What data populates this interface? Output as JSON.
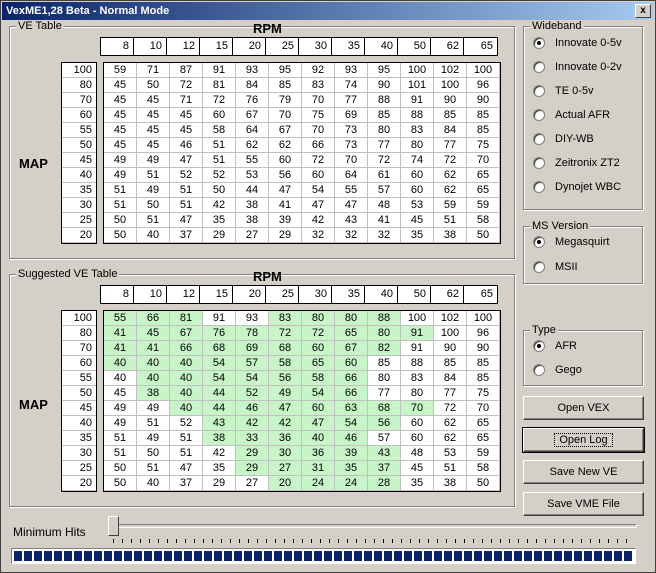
{
  "window": {
    "title": "VexME1,28 Beta - Normal Mode",
    "close_label": "x"
  },
  "ve_table": {
    "group_label": "VE Table",
    "rpm_label": "RPM",
    "map_label": "MAP",
    "rpm": [
      "8",
      "10",
      "12",
      "15",
      "20",
      "25",
      "30",
      "35",
      "40",
      "50",
      "62",
      "65"
    ],
    "map": [
      "100",
      "80",
      "70",
      "60",
      "55",
      "50",
      "45",
      "40",
      "35",
      "30",
      "25",
      "20"
    ],
    "rows": [
      [
        "59",
        "71",
        "87",
        "91",
        "93",
        "95",
        "92",
        "93",
        "95",
        "100",
        "102",
        "100"
      ],
      [
        "45",
        "50",
        "72",
        "81",
        "84",
        "85",
        "83",
        "74",
        "90",
        "101",
        "100",
        "96"
      ],
      [
        "45",
        "45",
        "71",
        "72",
        "76",
        "79",
        "70",
        "77",
        "88",
        "91",
        "90",
        "90"
      ],
      [
        "45",
        "45",
        "45",
        "60",
        "67",
        "70",
        "75",
        "69",
        "85",
        "88",
        "85",
        "85"
      ],
      [
        "45",
        "45",
        "45",
        "58",
        "64",
        "67",
        "70",
        "73",
        "80",
        "83",
        "84",
        "85"
      ],
      [
        "45",
        "45",
        "46",
        "51",
        "62",
        "62",
        "66",
        "73",
        "77",
        "80",
        "77",
        "75"
      ],
      [
        "49",
        "49",
        "47",
        "51",
        "55",
        "60",
        "72",
        "70",
        "72",
        "74",
        "72",
        "70"
      ],
      [
        "49",
        "51",
        "52",
        "52",
        "53",
        "56",
        "60",
        "64",
        "61",
        "60",
        "62",
        "65"
      ],
      [
        "51",
        "49",
        "51",
        "50",
        "44",
        "47",
        "54",
        "55",
        "57",
        "60",
        "62",
        "65"
      ],
      [
        "51",
        "50",
        "51",
        "42",
        "38",
        "41",
        "47",
        "47",
        "48",
        "53",
        "59",
        "59"
      ],
      [
        "50",
        "51",
        "47",
        "35",
        "38",
        "39",
        "42",
        "43",
        "41",
        "45",
        "51",
        "58"
      ],
      [
        "50",
        "40",
        "37",
        "29",
        "27",
        "29",
        "32",
        "32",
        "32",
        "35",
        "38",
        "50"
      ]
    ]
  },
  "suggested_table": {
    "group_label": "Suggested VE Table",
    "rpm_label": "RPM",
    "map_label": "MAP",
    "rpm": [
      "8",
      "10",
      "12",
      "15",
      "20",
      "25",
      "30",
      "35",
      "40",
      "50",
      "62",
      "65"
    ],
    "map": [
      "100",
      "80",
      "70",
      "60",
      "55",
      "50",
      "45",
      "40",
      "35",
      "30",
      "25",
      "20"
    ],
    "rows": [
      [
        "55",
        "66",
        "81",
        "91",
        "93",
        "83",
        "80",
        "80",
        "88",
        "100",
        "102",
        "100"
      ],
      [
        "41",
        "45",
        "67",
        "76",
        "78",
        "72",
        "72",
        "65",
        "80",
        "91",
        "100",
        "96"
      ],
      [
        "41",
        "41",
        "66",
        "68",
        "69",
        "68",
        "60",
        "67",
        "82",
        "91",
        "90",
        "90"
      ],
      [
        "40",
        "40",
        "40",
        "54",
        "57",
        "58",
        "65",
        "60",
        "85",
        "88",
        "85",
        "85"
      ],
      [
        "40",
        "40",
        "40",
        "54",
        "54",
        "56",
        "58",
        "66",
        "80",
        "83",
        "84",
        "85"
      ],
      [
        "45",
        "38",
        "40",
        "44",
        "52",
        "49",
        "54",
        "66",
        "77",
        "80",
        "77",
        "75"
      ],
      [
        "49",
        "49",
        "40",
        "44",
        "46",
        "47",
        "60",
        "63",
        "68",
        "70",
        "72",
        "70"
      ],
      [
        "49",
        "51",
        "52",
        "43",
        "42",
        "42",
        "47",
        "54",
        "56",
        "60",
        "62",
        "65"
      ],
      [
        "51",
        "49",
        "51",
        "38",
        "33",
        "36",
        "40",
        "46",
        "57",
        "60",
        "62",
        "65"
      ],
      [
        "51",
        "50",
        "51",
        "42",
        "29",
        "30",
        "36",
        "39",
        "43",
        "48",
        "53",
        "59"
      ],
      [
        "50",
        "51",
        "47",
        "35",
        "29",
        "27",
        "31",
        "35",
        "37",
        "45",
        "51",
        "58"
      ],
      [
        "50",
        "40",
        "37",
        "29",
        "27",
        "20",
        "24",
        "24",
        "28",
        "35",
        "38",
        "50"
      ]
    ],
    "highlight": [
      [
        1,
        1,
        1,
        0,
        0,
        1,
        1,
        1,
        1,
        0,
        0,
        0
      ],
      [
        1,
        1,
        1,
        1,
        1,
        1,
        1,
        1,
        1,
        1,
        0,
        0
      ],
      [
        1,
        1,
        1,
        1,
        1,
        1,
        1,
        1,
        1,
        0,
        0,
        0
      ],
      [
        1,
        1,
        1,
        1,
        1,
        1,
        1,
        1,
        0,
        0,
        0,
        0
      ],
      [
        0,
        1,
        1,
        1,
        1,
        1,
        1,
        1,
        0,
        0,
        0,
        0
      ],
      [
        0,
        1,
        1,
        1,
        1,
        1,
        1,
        1,
        0,
        0,
        0,
        0
      ],
      [
        0,
        0,
        1,
        1,
        1,
        1,
        1,
        1,
        1,
        1,
        0,
        0
      ],
      [
        0,
        0,
        0,
        1,
        1,
        1,
        1,
        1,
        1,
        0,
        0,
        0
      ],
      [
        0,
        0,
        0,
        1,
        1,
        1,
        1,
        1,
        0,
        0,
        0,
        0
      ],
      [
        0,
        0,
        0,
        0,
        1,
        1,
        1,
        1,
        1,
        0,
        0,
        0
      ],
      [
        0,
        0,
        0,
        0,
        1,
        1,
        1,
        1,
        1,
        0,
        0,
        0
      ],
      [
        0,
        0,
        0,
        0,
        0,
        1,
        1,
        1,
        1,
        0,
        0,
        0
      ]
    ]
  },
  "wideband": {
    "label": "Wideband",
    "options": [
      "Innovate 0-5v",
      "Innovate 0-2v",
      "TE 0-5v",
      "Actual AFR",
      "DIY-WB",
      "Zeitronix ZT2",
      "Dynojet WBC"
    ],
    "selected": 0
  },
  "ms_version": {
    "label": "MS Version",
    "options": [
      "Megasquirt",
      "MSII"
    ],
    "selected": 0
  },
  "type_group": {
    "label": "Type",
    "options": [
      "AFR",
      "Gego"
    ],
    "selected": 0
  },
  "buttons": {
    "open_vex": "Open VEX",
    "open_log": "Open Log",
    "save_new_ve": "Save New VE",
    "save_vme_file": "Save VME File"
  },
  "slider": {
    "label": "Minimum Hits",
    "value": 0
  },
  "progress": {
    "value": 1.0
  },
  "colors": {
    "highlight": "#c8f5c8",
    "title_bar": "#0a246a"
  }
}
